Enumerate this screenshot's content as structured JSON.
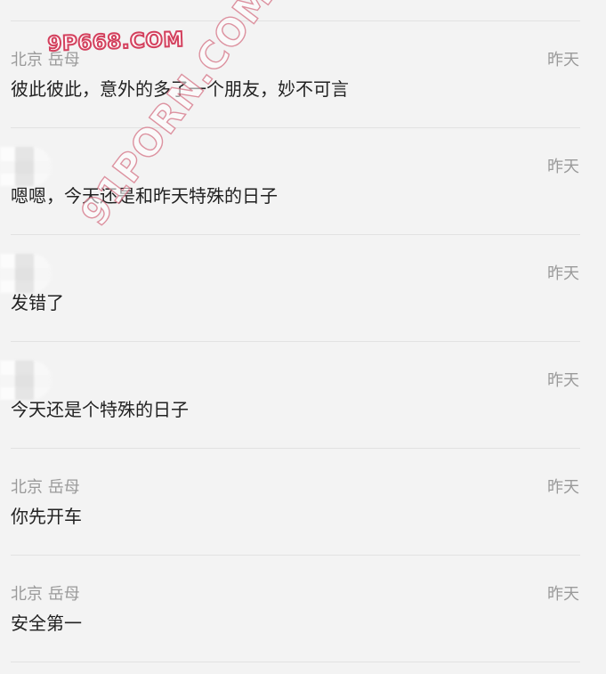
{
  "watermarks": {
    "top": "9P668.COM",
    "diagonal": "91PORN.COM"
  },
  "comments": [
    {
      "author": "北京 岳母",
      "time": "昨天",
      "text": "彼此彼此，意外的多了一个朋友，妙不可言"
    },
    {
      "author": "",
      "time": "昨天",
      "text": "嗯嗯，今天还是和昨天特殊的日子"
    },
    {
      "author": "",
      "time": "昨天",
      "text": "发错了"
    },
    {
      "author": "",
      "time": "昨天",
      "text": "今天还是个特殊的日子"
    },
    {
      "author": "北京 岳母",
      "time": "昨天",
      "text": "你先开车"
    },
    {
      "author": "北京 岳母",
      "time": "昨天",
      "text": "安全第一"
    }
  ]
}
